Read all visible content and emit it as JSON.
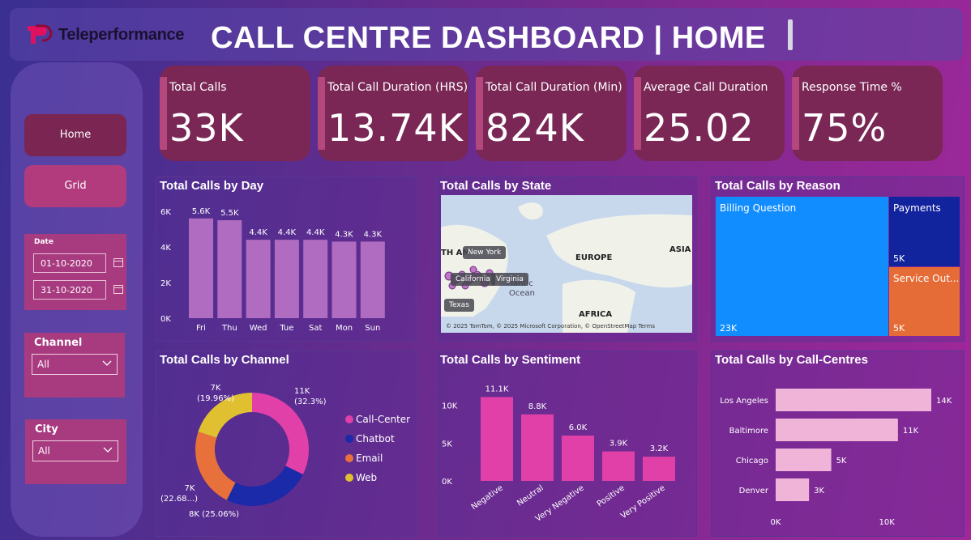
{
  "header": {
    "brand": "Teleperformance",
    "title": "CALL CENTRE DASHBOARD | HOME",
    "brand_color": "#e0115f"
  },
  "nav": {
    "home_label": "Home",
    "grid_label": "Grid"
  },
  "slicers": {
    "date": {
      "label": "Date",
      "start": "01-10-2020",
      "end": "31-10-2020"
    },
    "channel": {
      "label": "Channel",
      "value": "All"
    },
    "city": {
      "label": "City",
      "value": "All"
    }
  },
  "kpis": [
    {
      "label": "Total Calls",
      "value": "33K"
    },
    {
      "label": "Total Call Duration (HRS)",
      "value": "13.74K"
    },
    {
      "label": "Total Call Duration (Min)",
      "value": "824K"
    },
    {
      "label": "Average Call Duration",
      "value": "25.02"
    },
    {
      "label": "Response Time %",
      "value": "75%"
    }
  ],
  "panels": {
    "day": {
      "title": "Total Calls by Day"
    },
    "state": {
      "title": "Total Calls by State"
    },
    "reason": {
      "title": "Total Calls by Reason"
    },
    "channel": {
      "title": "Total Calls by Channel"
    },
    "sentiment": {
      "title": "Total Calls by Sentiment"
    },
    "callcentres": {
      "title": "Total Calls by Call-Centres"
    }
  },
  "map": {
    "labels": [
      "New York",
      "California",
      "Virginia",
      "Texas"
    ],
    "continent_europe": "EUROPE",
    "continent_asia": "ASIA",
    "continent_africa": "AFRICA",
    "continent_na": "TH AM",
    "ocean_line1": "lantic",
    "ocean_line2": "Ocean",
    "credit": "© 2025 TomTom, © 2025 Microsoft Corporation, © OpenStreetMap  Terms"
  },
  "colors": {
    "bar_day": "#b06cc0",
    "bar_sentiment": "#e040a8",
    "bar_callcentre": "#f0b4d8",
    "call_center": "#e040a8",
    "chatbot": "#1a2aa8",
    "email": "#e8703a",
    "web": "#e0c030",
    "tm_billing": "#118dff",
    "tm_payments": "#12239e",
    "tm_service": "#e66c37"
  },
  "chart_data": [
    {
      "type": "bar",
      "title": "Total Calls by Day",
      "categories": [
        "Fri",
        "Thu",
        "Wed",
        "Tue",
        "Sat",
        "Mon",
        "Sun"
      ],
      "values": [
        5600,
        5500,
        4400,
        4400,
        4400,
        4300,
        4300
      ],
      "data_labels": [
        "5.6K",
        "5.5K",
        "4.4K",
        "4.4K",
        "4.4K",
        "4.3K",
        "4.3K"
      ],
      "ylim": [
        0,
        6000
      ],
      "yticks": [
        "0K",
        "2K",
        "4K",
        "6K"
      ]
    },
    {
      "type": "treemap",
      "title": "Total Calls by Reason",
      "categories": [
        "Billing Question",
        "Payments",
        "Service Out..."
      ],
      "data_labels": [
        "23K",
        "5K",
        "5K"
      ],
      "values": [
        23000,
        5000,
        5000
      ]
    },
    {
      "type": "pie",
      "title": "Total Calls by Channel",
      "categories": [
        "Call-Center",
        "Chatbot",
        "Email",
        "Web"
      ],
      "values": [
        32.3,
        25.06,
        22.68,
        19.96
      ],
      "data_labels": [
        "11K\n(32.3%)",
        "8K (25.06%)",
        "7K\n(22.68...)",
        "7K\n(19.96%)"
      ],
      "legend": "right"
    },
    {
      "type": "bar",
      "title": "Total Calls by Sentiment",
      "categories": [
        "Negative",
        "Neutral",
        "Very Negative",
        "Positive",
        "Very Positive"
      ],
      "values": [
        11100,
        8800,
        6000,
        3900,
        3200
      ],
      "data_labels": [
        "11.1K",
        "8.8K",
        "6.0K",
        "3.9K",
        "3.2K"
      ],
      "ylim": [
        0,
        12000
      ],
      "yticks": [
        "0K",
        "5K",
        "10K"
      ]
    },
    {
      "type": "bar",
      "orientation": "horizontal",
      "title": "Total Calls by Call-Centres",
      "categories": [
        "Los Angeles",
        "Baltimore",
        "Chicago",
        "Denver"
      ],
      "values": [
        14000,
        11000,
        5000,
        3000
      ],
      "data_labels": [
        "14K",
        "11K",
        "5K",
        "3K"
      ],
      "xlim": [
        0,
        15000
      ],
      "xticks": [
        "0K",
        "10K"
      ]
    }
  ]
}
